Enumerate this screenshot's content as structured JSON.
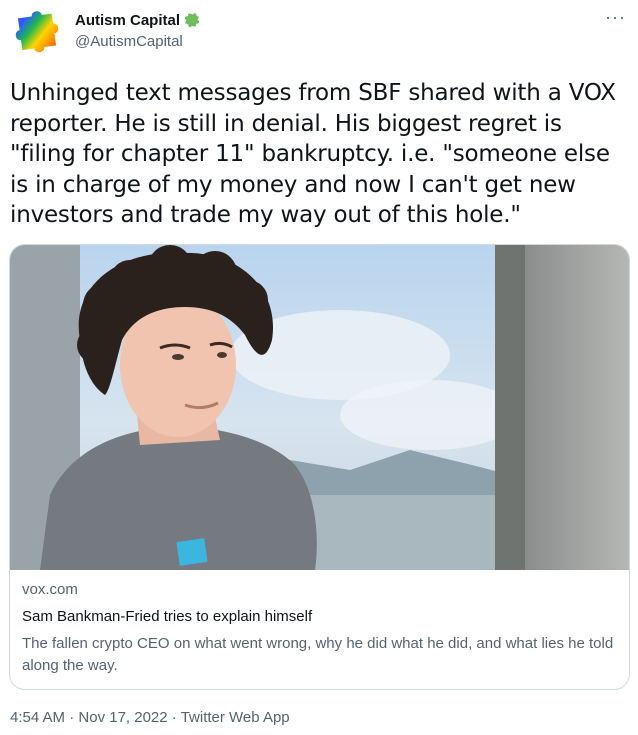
{
  "author": {
    "display_name": "Autism Capital",
    "handle": "@AutismCapital",
    "avatar_icon": "rainbow-puzzle-piece-icon",
    "badge_icon": "green-puzzle-piece-icon"
  },
  "menu": {
    "more_label": "···"
  },
  "tweet": {
    "text": "Unhinged text messages from SBF shared with a VOX reporter. He is still in denial. His biggest regret is \"filing for chapter 11\" bankruptcy. i.e. \"someone else is in charge of my money and now I can't get new investors and trade my way out of this hole.\""
  },
  "card": {
    "domain": "vox.com",
    "title": "Sam Bankman-Fried tries to explain himself",
    "description": "The fallen crypto CEO on what went wrong, why he did what he did, and what lies he told along the way."
  },
  "footer": {
    "time": "4:54 AM",
    "separator1": " · ",
    "date": "Nov 17, 2022",
    "separator2": " · ",
    "source": "Twitter Web App"
  },
  "colors": {
    "text_primary": "#0f1419",
    "text_secondary": "#536471",
    "border": "#cfd9de"
  }
}
